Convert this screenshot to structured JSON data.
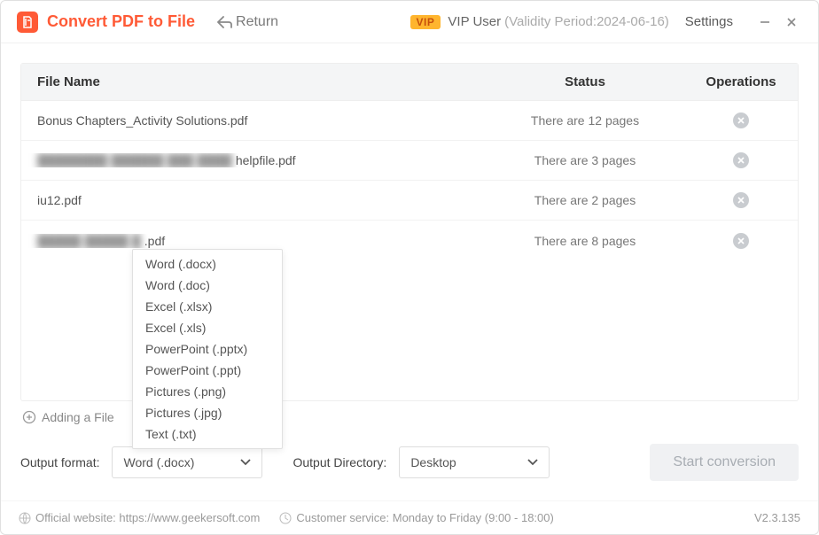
{
  "titlebar": {
    "app_title": "Convert PDF to File",
    "return_label": "Return",
    "vip_badge": "VIP",
    "vip_user": "VIP User",
    "validity": "(Validity Period:2024-06-16)",
    "settings": "Settings"
  },
  "table": {
    "headers": {
      "name": "File Name",
      "status": "Status",
      "ops": "Operations"
    },
    "rows": [
      {
        "name_prefix": "",
        "name": "Bonus Chapters_Activity Solutions.pdf",
        "status": "There are 12 pages"
      },
      {
        "name_prefix": "████████ ██████ ███ ████",
        "name": "helpfile.pdf",
        "status": "There are 3 pages"
      },
      {
        "name_prefix": "",
        "name": "iu12.pdf",
        "status": "There are 2 pages"
      },
      {
        "name_prefix": "█████ █████ █",
        "name": ".pdf",
        "status": "There are 8 pages"
      }
    ]
  },
  "add_file_label": "Adding a File",
  "options": {
    "format_label": "Output format:",
    "format_value": "Word (.docx)",
    "directory_label": "Output Directory:",
    "directory_value": "Desktop",
    "start_label": "Start conversion"
  },
  "dropdown_items": [
    "Word (.docx)",
    "Word (.doc)",
    "Excel (.xlsx)",
    "Excel (.xls)",
    "PowerPoint (.pptx)",
    "PowerPoint (.ppt)",
    "Pictures (.png)",
    "Pictures (.jpg)",
    "Text (.txt)"
  ],
  "footer": {
    "website_label": "Official website: https://www.geekersoft.com",
    "service_label": "Customer service: Monday to Friday (9:00 - 18:00)",
    "version": "V2.3.135"
  }
}
